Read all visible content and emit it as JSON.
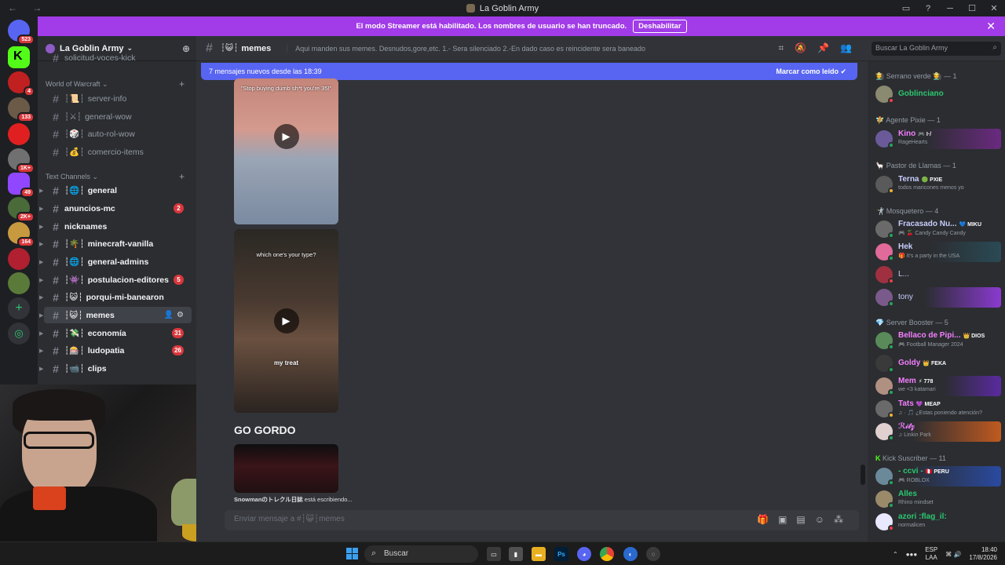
{
  "window": {
    "title": "La Goblin Army"
  },
  "banner": {
    "text": "El modo Streamer está habilitado. Los nombres de usuario se han truncado.",
    "button": "Deshabilitar"
  },
  "rail": {
    "badges": [
      "523",
      "4",
      "133",
      "1K+",
      "49",
      "2K+",
      "164"
    ]
  },
  "guild": {
    "name": "La Goblin Army"
  },
  "sidebar": {
    "partial_top": "solicitud-voces-kick",
    "cat_wow": "World of Warcraft",
    "wow_channels": [
      "server-info",
      "general-wow",
      "auto-rol-wow",
      "comercio-items"
    ],
    "cat_text": "Text Channels",
    "text_channels": [
      {
        "name": "general",
        "count": "",
        "bold": true
      },
      {
        "name": "anuncios-mc",
        "count": "2",
        "bold": true
      },
      {
        "name": "nicknames",
        "count": "",
        "bold": true
      },
      {
        "name": "minecraft-vanilla",
        "count": "",
        "bold": true
      },
      {
        "name": "general-admins",
        "count": "",
        "bold": true
      },
      {
        "name": "postulacion-editores",
        "count": "5",
        "bold": true
      },
      {
        "name": "porqui-mi-banearon",
        "count": "",
        "bold": true
      },
      {
        "name": "memes",
        "count": "",
        "bold": true
      },
      {
        "name": "economía",
        "count": "31",
        "bold": true
      },
      {
        "name": "ludopatia",
        "count": "26",
        "bold": true
      },
      {
        "name": "clips",
        "count": "",
        "bold": true
      }
    ]
  },
  "chat": {
    "channel": "memes",
    "topic": "Aqui manden sus memes. Desnudos,gore,etc. 1.- Sera silenciado 2.-En dado caso es reincidente sera baneado",
    "new_messages": "7 mensajes nuevos desde las 18:39",
    "mark_read": "Marcar como leído",
    "video1_caption": "\"Stop buying dumb sh*t you're 35!\"",
    "video2_top": "which one's your type?",
    "video2_bottom": "my treat",
    "message_text": "GO GORDO",
    "typing_user": "Snowmanのトレクル日誌",
    "typing_suffix": " está escribiendo...",
    "composer_placeholder": "Enviar mensaje a #┆😺┆memes",
    "search_placeholder": "Buscar La Goblin Army"
  },
  "members": {
    "groups": [
      {
        "label": "🧑‍🌾 Serrano verde 🧑‍🌾 — 1"
      },
      {
        "label": "🧚 Agente Pixie — 1"
      },
      {
        "label": "🦙 Pastor de Llamas — 1"
      },
      {
        "label": "🤺 Mosquetero — 4"
      },
      {
        "label": "💎 Server Booster — 5"
      },
      {
        "label": "Kick Suscriber — 11"
      }
    ],
    "list": [
      {
        "name": "Goblinciano",
        "sub": "",
        "color": "#2dc770",
        "tag": ""
      },
      {
        "name": "Kino",
        "sub": "RageHearts",
        "color": "#f47fff",
        "tag": "🎮 I·/"
      },
      {
        "name": "Terna",
        "sub": "todos maricones menos yo",
        "color": "#c9cdfb",
        "tag": "🟢 PXIE"
      },
      {
        "name": "Fracasado Nu...",
        "sub": "🎮 🍒 Candy Candy Candy",
        "color": "#c9cdfb",
        "tag": "💙 MIKU"
      },
      {
        "name": "Hek",
        "sub": "🎁 It's a party in the USA",
        "color": "#c9cdfb",
        "tag": ""
      },
      {
        "name": "L...",
        "sub": "",
        "color": "#c9cdfb",
        "tag": ""
      },
      {
        "name": "tony",
        "sub": "",
        "color": "#c9cdfb",
        "tag": ""
      },
      {
        "name": "Bellaco de Pipi...",
        "sub": "🎮 Football Manager 2024",
        "color": "#f47fff",
        "tag": "👑 DIOS"
      },
      {
        "name": "Goldy",
        "sub": "",
        "color": "#f47fff",
        "tag": "👑 FEKA"
      },
      {
        "name": "Mem",
        "sub": "we <3 katamari",
        "color": "#f47fff",
        "tag": "⚡ 778"
      },
      {
        "name": "Tats",
        "sub": "♫ · 🎵 ¿Estas poniendo atención?",
        "color": "#f47fff",
        "tag": "💜 MEAP"
      },
      {
        "name": "ℛ𝒾𝓉𝓏",
        "sub": "♫ Linkin Park",
        "color": "#f47fff",
        "tag": ""
      },
      {
        "name": "- ccvi -",
        "sub": "🎮 ROBLOX",
        "color": "#2dc770",
        "tag": "🇵🇪 PERU"
      },
      {
        "name": "Alles",
        "sub": "Rhino mindset",
        "color": "#2dc770",
        "tag": ""
      },
      {
        "name": "azori :flag_il:",
        "sub": "normalicen",
        "color": "#2dc770",
        "tag": ""
      }
    ]
  },
  "taskbar": {
    "search": "Buscar",
    "lang1": "ESP",
    "lang2": "LAA",
    "time": "18:40",
    "date": "17/8/2026"
  }
}
